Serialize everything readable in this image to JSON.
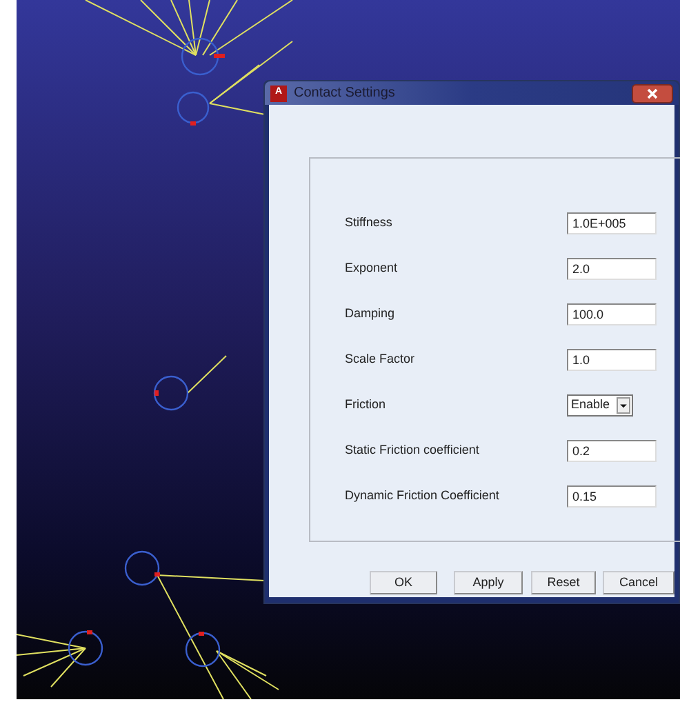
{
  "dialog": {
    "title": "Contact Settings",
    "icon_letter": "A"
  },
  "fields": [
    {
      "kind": "text",
      "label": "Stiffness",
      "value": "1.0E+005"
    },
    {
      "kind": "text",
      "label": "Exponent",
      "value": "2.0"
    },
    {
      "kind": "text",
      "label": "Damping",
      "value": "100.0"
    },
    {
      "kind": "text",
      "label": "Scale Factor",
      "value": "1.0"
    },
    {
      "kind": "dropdown",
      "label": "Friction",
      "value": "Enable"
    },
    {
      "kind": "text",
      "label": "Static Friction coefficient",
      "value": "0.2"
    },
    {
      "kind": "text",
      "label": "Dynamic Friction Coefficient",
      "value": "0.15"
    }
  ],
  "buttons": [
    "OK",
    "Apply",
    "Reset",
    "Cancel"
  ]
}
